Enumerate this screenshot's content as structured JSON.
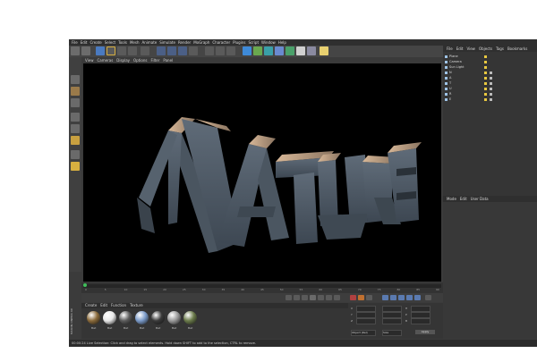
{
  "menubar": [
    "File",
    "Edit",
    "Create",
    "Select",
    "Tools",
    "Mesh",
    "Animate",
    "Simulate",
    "Render",
    "MoGraph",
    "Character",
    "Plugins",
    "Script",
    "Window",
    "Help"
  ],
  "viewport_menu": [
    "View",
    "Cameras",
    "Display",
    "Options",
    "Filter",
    "Panel"
  ],
  "viewport_text": "NATURE",
  "timeline_ticks": [
    "0",
    "5",
    "10",
    "15",
    "20",
    "25",
    "30",
    "35",
    "40",
    "45",
    "50",
    "55",
    "60",
    "65",
    "70",
    "75",
    "80",
    "85",
    "90"
  ],
  "material_menu": [
    "Create",
    "Edit",
    "Function",
    "Texture"
  ],
  "materials": [
    {
      "label": "Mat",
      "color": "#8a6a3a"
    },
    {
      "label": "Mat",
      "color": "#e8e8e8"
    },
    {
      "label": "Mat",
      "color": "#5c5c5c"
    },
    {
      "label": "Mat",
      "color": "#7a9ac8"
    },
    {
      "label": "Mat",
      "color": "#3a3a3a"
    },
    {
      "label": "Mat",
      "color": "#9a9a9a"
    },
    {
      "label": "Mat",
      "color": "#6a7a4a"
    }
  ],
  "coord_labels": [
    "X",
    "Y",
    "Z",
    "H",
    "P",
    "B"
  ],
  "coord_dropdown": "Object (Rel)",
  "coord_size_dropdown": "Size",
  "apply_label": "Apply",
  "object_menu": [
    "File",
    "Edit",
    "View",
    "Objects",
    "Tags",
    "Bookmarks"
  ],
  "objects": [
    {
      "name": "Plane"
    },
    {
      "name": "Camera"
    },
    {
      "name": "Sun Light"
    },
    {
      "name": "N"
    },
    {
      "name": "A"
    },
    {
      "name": "T"
    },
    {
      "name": "U"
    },
    {
      "name": "R"
    },
    {
      "name": "E"
    }
  ],
  "attr_menu": [
    "Mode",
    "Edit",
    "User Data"
  ],
  "status_text": "00:00:24   Live Selection: Click and drag to select elements. Hold down SHIFT to add to the selection, CTRL to remove.",
  "vertical_label": "MAXON CINEMA 4D"
}
